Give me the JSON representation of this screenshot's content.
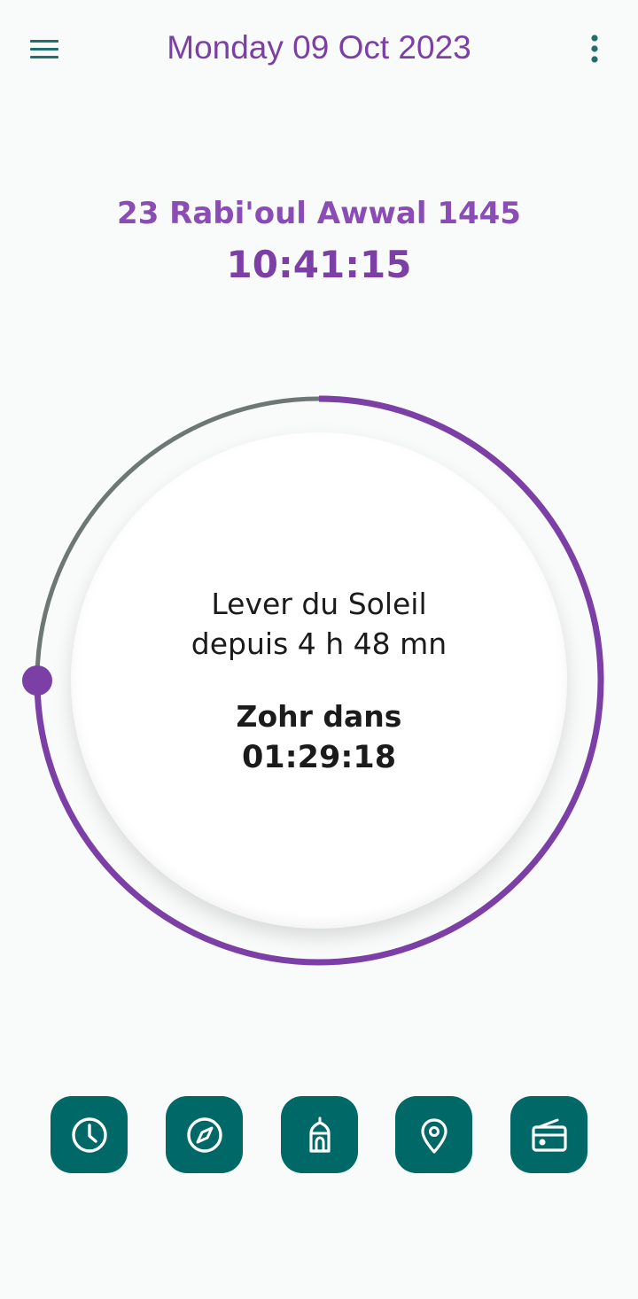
{
  "header": {
    "date_title": "Monday 09 Oct 2023",
    "menu_icon": "hamburger-menu-icon",
    "more_icon": "more-vertical-icon"
  },
  "hijri": {
    "date": "23 Rabi'oul Awwal 1445",
    "time": "10:41:15"
  },
  "dial": {
    "status_line_1": "Lever du Soleil",
    "status_line_2": "depuis 4 h 48 mn",
    "next_prayer_label": "Zohr dans",
    "countdown": "01:29:18",
    "progress_fraction": 0.75,
    "colors": {
      "progress": "#7b3fa6",
      "remaining": "#6d7775",
      "marker": "#7b3fa6"
    }
  },
  "bottom_nav": {
    "color": "#006867",
    "items": [
      {
        "icon": "clock-icon"
      },
      {
        "icon": "compass-icon"
      },
      {
        "icon": "mosque-icon"
      },
      {
        "icon": "location-pin-icon"
      },
      {
        "icon": "radio-icon"
      }
    ]
  },
  "colors": {
    "accent": "#7b3fa6",
    "primary": "#006867",
    "background": "#f9fafa"
  }
}
